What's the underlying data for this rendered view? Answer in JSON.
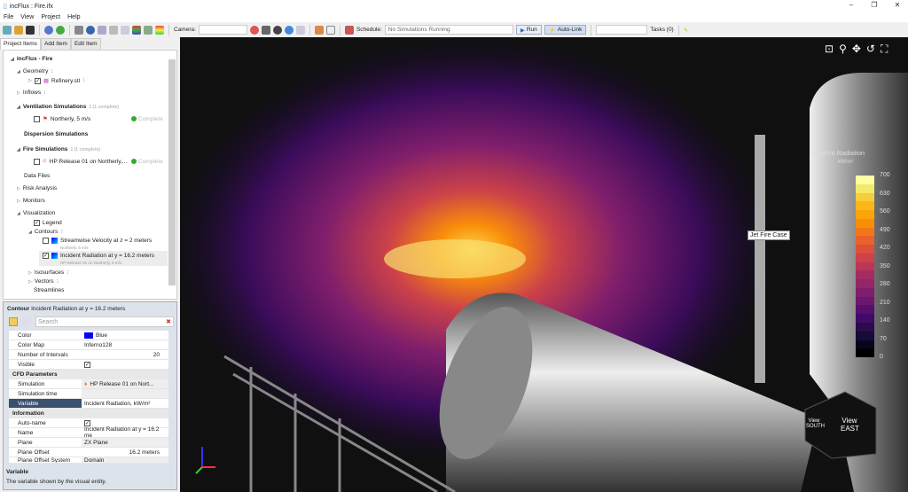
{
  "window": {
    "title": "incFlux : Fire.ifx",
    "min": "–",
    "max": "❐",
    "close": "✕"
  },
  "menu": [
    "File",
    "View",
    "Project",
    "Help"
  ],
  "toolbar": {
    "camera_label": "Camera:",
    "camera_value": "",
    "schedule_label": "Schedule:",
    "schedule_value": "No Simulations Running",
    "run": "Run",
    "autolink": "Auto-Link",
    "tasks": "Tasks (0)"
  },
  "tabs": [
    "Project Items",
    "Add Item",
    "Edit Item"
  ],
  "tree": {
    "root": "incFlux - Fire",
    "geometry": "Geometry",
    "geometry_count": "1",
    "refinery": "Refinery.stl",
    "refinery_count": "1",
    "inflows": "Inflows",
    "inflows_count": "1",
    "vent": "Ventilation Simulations",
    "vent_count": "1 (1 complete)",
    "vent_item": "Northerly, 5 m/s",
    "status": "Complete",
    "dispersion": "Dispersion Simulations",
    "fire": "Fire Simulations",
    "fire_count": "1 (1 complete)",
    "fire_item": "HP Release 01 on Northerly,...",
    "datafiles": "Data Files",
    "risk": "Risk Analysis",
    "monitors": "Monitors",
    "vis": "Visualization",
    "legend": "Legend",
    "contours": "Contours",
    "contours_count": "2",
    "c1": "Streamwise Velocity at z = 2 meters",
    "c1_sub": "Northerly, 5 m/s",
    "c2": "Incident Radiation at y = 16.2 meters",
    "c2_sub": "HP Release 01 on Northerly, 5 m/s",
    "iso": "Isosurfaces",
    "iso_count": "2",
    "vectors": "Vectors",
    "vectors_count": "1",
    "streamlines": "Streamlines"
  },
  "props": {
    "header_type": "Contour",
    "header_name": "Incident Radiation at y = 16.2 meters",
    "search_placeholder": "Search",
    "color_k": "Color",
    "color_v": "Blue",
    "colormap_k": "Color Map",
    "colormap_v": "Inferno128",
    "intervals_k": "Number of Intervals",
    "intervals_v": "20",
    "visible_k": "Visible",
    "cfd": "CFD Parameters",
    "sim_k": "Simulation",
    "sim_v": "HP Release 01 on Nort...",
    "simtime_k": "Simulation time",
    "simtime_v": "",
    "var_k": "Variable",
    "var_v": "Incident Radiation, kW/m²",
    "info": "Information",
    "autoname_k": "Auto-name",
    "name_k": "Name",
    "name_v": "Incident Radiation at y = 16.2 me",
    "plane_k": "Plane",
    "plane_v": "ZX Plane",
    "offset_k": "Plane Offset",
    "offset_v": "16.2 meters",
    "offsys_k": "Plane Offset System",
    "offsys_v": "Domain",
    "desc_title": "Variable",
    "desc": "The variable shown by the visual entity."
  },
  "viewport": {
    "annotation": "Jet Fire Case",
    "cube_south": "View SOUTH",
    "cube_east": "View EAST"
  },
  "legend": {
    "title": "Incident Radiation",
    "units": "kW/m²",
    "ticks": [
      "700",
      "630",
      "560",
      "490",
      "420",
      "350",
      "280",
      "210",
      "140",
      "70",
      "0"
    ],
    "colors": [
      "#fcffa4",
      "#f2ea69",
      "#f8cd37",
      "#fbb61a",
      "#fca50a",
      "#f98e09",
      "#f3761b",
      "#e9612b",
      "#dc5039",
      "#cc4248",
      "#ba3655",
      "#a52c60",
      "#932667",
      "#7f1e6c",
      "#6b176e",
      "#570f6d",
      "#420a68",
      "#2c0b4c",
      "#160b39",
      "#07051d",
      "#000004"
    ]
  }
}
